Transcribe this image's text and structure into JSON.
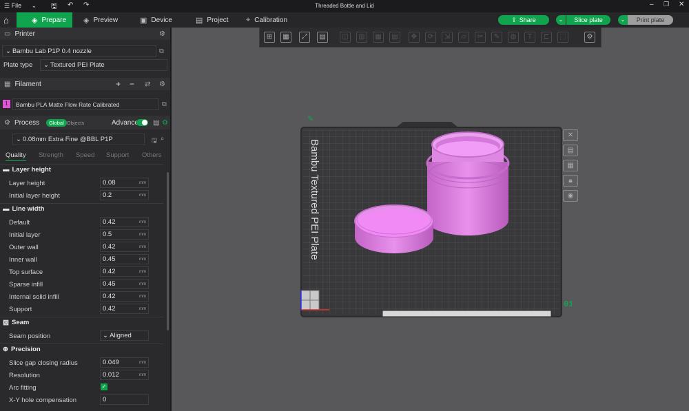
{
  "window": {
    "file_menu": "File",
    "title": "Threaded Bottle and Lid"
  },
  "nav": {
    "tabs": [
      {
        "label": "Prepare",
        "icon": "cube-icon"
      },
      {
        "label": "Preview",
        "icon": "layers-icon"
      },
      {
        "label": "Device",
        "icon": "device-icon"
      },
      {
        "label": "Project",
        "icon": "project-icon"
      },
      {
        "label": "Calibration",
        "icon": "calibration-icon"
      }
    ],
    "share_label": "Share",
    "slice_label": "Slice plate",
    "print_label": "Print plate"
  },
  "printer": {
    "section_title": "Printer",
    "model": "Bambu Lab P1P 0.4 nozzle",
    "plate_type_label": "Plate type",
    "plate_type": "Textured PEI Plate"
  },
  "filament": {
    "section_title": "Filament",
    "slot": "1",
    "name": "Bambu PLA Matte Flow Rate Calibrated",
    "slot_color": "#e055d8"
  },
  "process": {
    "section_title": "Process",
    "toggle_global": "Global",
    "toggle_objects": "Objects",
    "advance_label": "Advance",
    "preset": "0.08mm Extra Fine @BBL P1P",
    "tabs": [
      "Quality",
      "Strength",
      "Speed",
      "Support",
      "Others"
    ],
    "groups": {
      "layer_height": {
        "title": "Layer height",
        "rows": [
          {
            "label": "Layer height",
            "value": "0.08",
            "unit": "mm"
          },
          {
            "label": "Initial layer height",
            "value": "0.2",
            "unit": "mm"
          }
        ]
      },
      "line_width": {
        "title": "Line width",
        "rows": [
          {
            "label": "Default",
            "value": "0.42",
            "unit": "mm"
          },
          {
            "label": "Initial layer",
            "value": "0.5",
            "unit": "mm"
          },
          {
            "label": "Outer wall",
            "value": "0.42",
            "unit": "mm"
          },
          {
            "label": "Inner wall",
            "value": "0.45",
            "unit": "mm"
          },
          {
            "label": "Top surface",
            "value": "0.42",
            "unit": "mm"
          },
          {
            "label": "Sparse infill",
            "value": "0.45",
            "unit": "mm"
          },
          {
            "label": "Internal solid infill",
            "value": "0.42",
            "unit": "mm"
          },
          {
            "label": "Support",
            "value": "0.42",
            "unit": "mm"
          }
        ]
      },
      "seam": {
        "title": "Seam",
        "position_label": "Seam position",
        "position_value": "Aligned"
      },
      "precision": {
        "title": "Precision",
        "rows": [
          {
            "label": "Slice gap closing radius",
            "value": "0.049",
            "unit": "mm"
          },
          {
            "label": "Resolution",
            "value": "0.012",
            "unit": "mm"
          }
        ],
        "arc_fitting_label": "Arc fitting",
        "xy_hole_label": "X-Y hole compensation",
        "xy_hole_value": "0"
      }
    }
  },
  "viewport": {
    "plate_text": "Bambu Textured PEI Plate",
    "plate_number": "01",
    "bed_color": "#39393b",
    "model_color": "#e07ee8"
  }
}
